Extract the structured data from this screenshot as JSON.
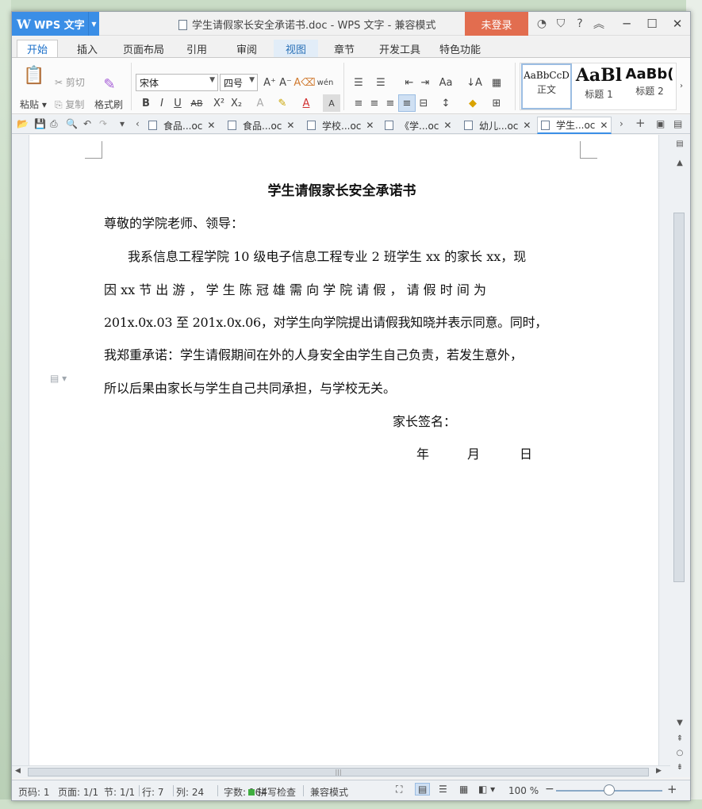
{
  "app": {
    "name": "WPS 文字",
    "title": "学生请假家长安全承诺书.doc - WPS 文字 - 兼容模式",
    "login_label": "未登录"
  },
  "tabs": [
    "开始",
    "插入",
    "页面布局",
    "引用",
    "审阅",
    "视图",
    "章节",
    "开发工具",
    "特色功能"
  ],
  "ribbon": {
    "paste": "粘贴",
    "cut": "剪切",
    "copy": "复制",
    "format_painter": "格式刷",
    "font": "宋体",
    "size": "四号",
    "styles": [
      {
        "sample": "AaBbCcD",
        "name": "正文"
      },
      {
        "sample": "AaBl",
        "name": "标题 1"
      },
      {
        "sample": "AaBb(",
        "name": "标题 2"
      }
    ]
  },
  "doc_tabs": [
    "食品...oc",
    "食品...oc",
    "学校...oc",
    "《学...oc",
    "幼儿...oc",
    "学生...oc"
  ],
  "document": {
    "title": "学生请假家长安全承诺书",
    "salutation": "尊敬的学院老师、领导：",
    "lines": [
      "我系信息工程学院 10 级电子信息工程专业 2 班学生 xx 的家长 xx，现",
      "因 xx 节 出 游 ， 学 生 陈 冠 雄 需 向 学 院 请 假 ， 请 假 时 间 为",
      "201x.0x.03 至 201x.0x.06，对学生向学院提出请假我知晓并表示同意。同时，",
      "我郑重承诺：学生请假期间在外的人身安全由学生自己负责，若发生意外，",
      "所以后果由家长与学生自己共同承担，与学校无关。"
    ],
    "signature": "家长签名：",
    "date_year": "年",
    "date_month": "月",
    "date_day": "日"
  },
  "status": {
    "page_num": "页码: 1",
    "pages": "页面: 1/1",
    "section": "节: 1/1",
    "row": "行: 7",
    "col": "列: 24",
    "words": "字数: 164",
    "spell": "拼写检查",
    "compat": "兼容模式",
    "zoom": "100 %"
  },
  "colors": {
    "accent": "#3a8ee6",
    "login": "#e26d4f"
  }
}
